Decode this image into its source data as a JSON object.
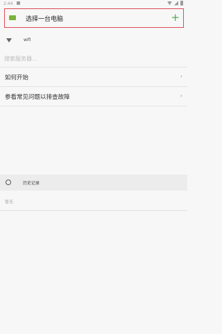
{
  "status_bar": {
    "time": "2:44"
  },
  "header": {
    "title": "选择一台电脑",
    "add_label": "+"
  },
  "network": {
    "label": "wifi"
  },
  "search": {
    "placeholder": "搜索服务器..."
  },
  "menu": {
    "items": [
      {
        "label": "如何开始",
        "chevron": "›"
      },
      {
        "label": "参看常见问题以排查故障",
        "chevron": "›"
      }
    ]
  },
  "history": {
    "title": "历史记录",
    "empty_text": "暂无"
  },
  "colors": {
    "accent_green": "#4caf50",
    "highlight_border": "#e04a55"
  }
}
